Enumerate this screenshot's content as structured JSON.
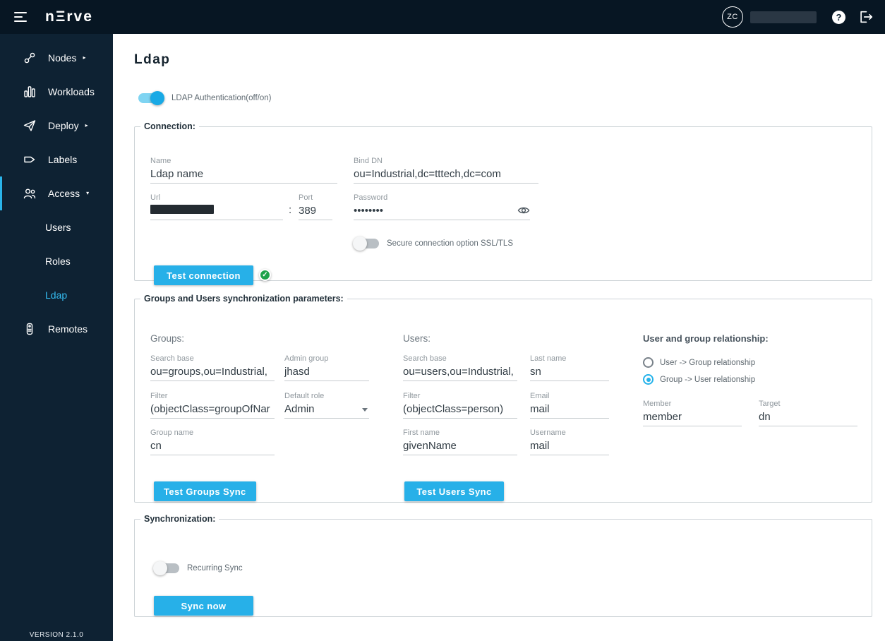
{
  "header": {
    "logo": "nΞrve",
    "avatar_initials": "ZC",
    "help_label": "?"
  },
  "sidebar": {
    "items": [
      {
        "label": "Nodes"
      },
      {
        "label": "Workloads"
      },
      {
        "label": "Deploy"
      },
      {
        "label": "Labels"
      },
      {
        "label": "Access"
      },
      {
        "label": "Users"
      },
      {
        "label": "Roles"
      },
      {
        "label": "Ldap"
      },
      {
        "label": "Remotes"
      }
    ],
    "version": "VERSION 2.1.0"
  },
  "page": {
    "title": "Ldap",
    "ldap_toggle_label": "LDAP Authentication(off/on)"
  },
  "connection": {
    "legend": "Connection:",
    "name": {
      "label": "Name",
      "value": "Ldap name"
    },
    "bind_dn": {
      "label": "Bind DN",
      "value": "ou=Industrial,dc=tttech,dc=com"
    },
    "url": {
      "label": "Url",
      "value": ""
    },
    "port_separator": ":",
    "port": {
      "label": "Port",
      "value": "389"
    },
    "password": {
      "label": "Password",
      "value": "••••••••"
    },
    "ssl_toggle_label": "Secure connection option SSL/TLS",
    "test_button": "Test connection"
  },
  "sync_params": {
    "legend": "Groups and Users synchronization parameters:",
    "groups": {
      "heading": "Groups:",
      "search_base": {
        "label": "Search base",
        "value": "ou=groups,ou=Industrial,"
      },
      "admin_group": {
        "label": "Admin group",
        "value": "jhasd"
      },
      "filter": {
        "label": "Filter",
        "value": "(objectClass=groupOfNar"
      },
      "default_role": {
        "label": "Default role",
        "value": "Admin"
      },
      "group_name": {
        "label": "Group name",
        "value": "cn"
      },
      "test_button": "Test Groups Sync"
    },
    "users": {
      "heading": "Users:",
      "search_base": {
        "label": "Search base",
        "value": "ou=users,ou=Industrial,"
      },
      "last_name": {
        "label": "Last name",
        "value": "sn"
      },
      "filter": {
        "label": "Filter",
        "value": "(objectClass=person)"
      },
      "email": {
        "label": "Email",
        "value": "mail"
      },
      "first_name": {
        "label": "First name",
        "value": "givenName"
      },
      "username": {
        "label": "Username",
        "value": "mail"
      },
      "test_button": "Test Users Sync"
    },
    "relationship": {
      "heading": "User and group relationship:",
      "options": [
        {
          "label": "User -> Group relationship",
          "selected": false
        },
        {
          "label": "Group -> User relationship",
          "selected": true
        }
      ],
      "member": {
        "label": "Member",
        "value": "member"
      },
      "target": {
        "label": "Target",
        "value": "dn"
      }
    }
  },
  "synchronization": {
    "legend": "Synchronization:",
    "recurring_toggle_label": "Recurring Sync",
    "sync_button": "Sync now"
  }
}
